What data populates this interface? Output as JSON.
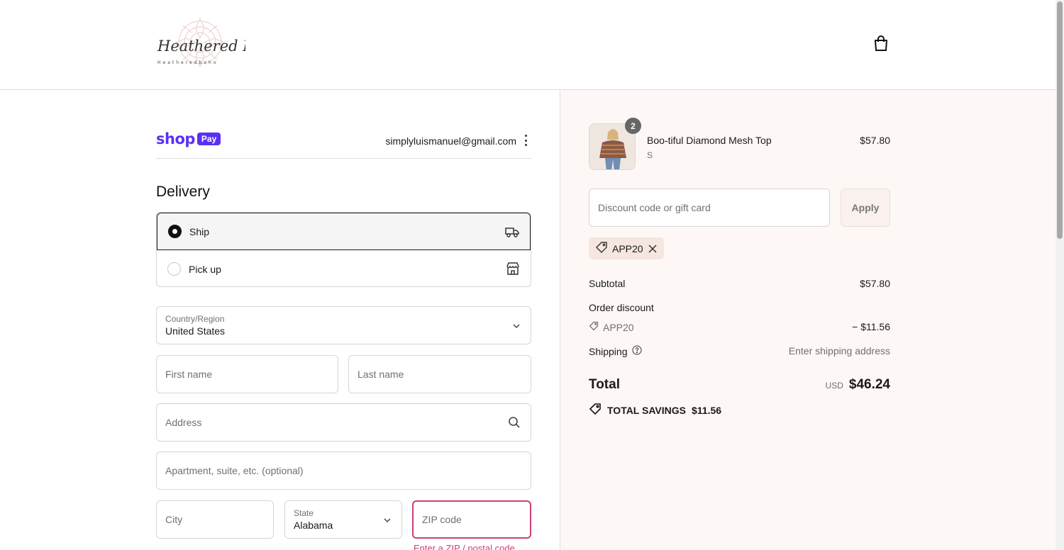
{
  "header": {
    "logo_text": "Heathered Boho",
    "logo_subtext": "Heatheredboho",
    "cart_icon": "shopping-bag-icon"
  },
  "shop_pay": {
    "shop": "shop",
    "pay": "Pay",
    "email": "simplyluismanuel@gmail.com"
  },
  "delivery": {
    "heading": "Delivery",
    "options": [
      {
        "label": "Ship",
        "icon": "truck-icon",
        "selected": true
      },
      {
        "label": "Pick up",
        "icon": "store-icon",
        "selected": false
      }
    ]
  },
  "form": {
    "country_label": "Country/Region",
    "country_value": "United States",
    "first_name_placeholder": "First name",
    "last_name_placeholder": "Last name",
    "address_placeholder": "Address",
    "apartment_placeholder": "Apartment, suite, etc. (optional)",
    "city_placeholder": "City",
    "state_label": "State",
    "state_value": "Alabama",
    "zip_placeholder": "ZIP code",
    "zip_error": "Enter a ZIP / postal code"
  },
  "order": {
    "product": {
      "name": "Boo-tiful Diamond Mesh Top",
      "variant": "S",
      "price": "$57.80",
      "quantity": "2"
    },
    "discount_placeholder": "Discount code or gift card",
    "apply_label": "Apply",
    "applied_code": "APP20",
    "subtotal_label": "Subtotal",
    "subtotal_value": "$57.80",
    "order_discount_label": "Order discount",
    "discount_code": "APP20",
    "discount_value": "− $11.56",
    "shipping_label": "Shipping",
    "shipping_value": "Enter shipping address",
    "total_label": "Total",
    "total_currency": "USD",
    "total_value": "$46.24",
    "savings_label": "TOTAL SAVINGS",
    "savings_value": "$11.56"
  },
  "colors": {
    "shop_purple": "#5a31f4",
    "summary_bg": "#fdf8f6",
    "chip_bg": "#f5e6df",
    "error_pink": "#c8417a"
  }
}
